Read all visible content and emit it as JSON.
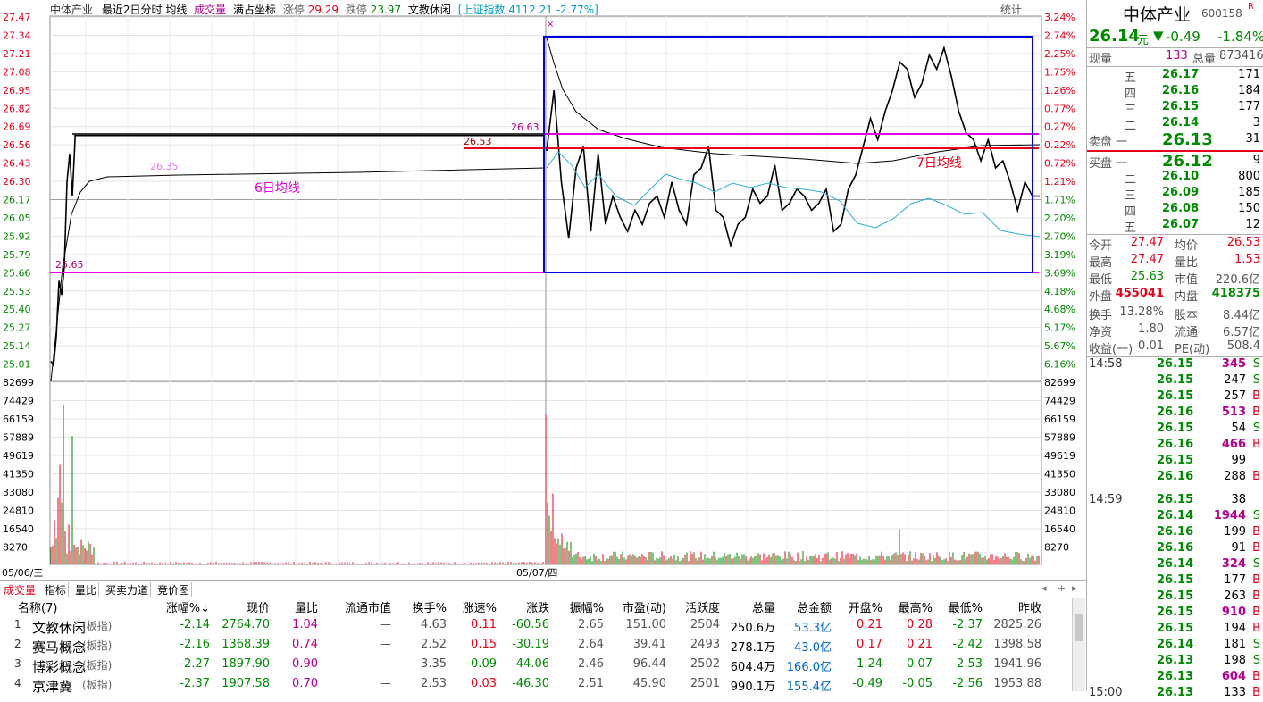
{
  "header": {
    "stock_name": "中体产业",
    "mode": "最近2日分时",
    "avg_label": "均线",
    "vol_label": "成交量",
    "fill_label": "满占坐标",
    "limit_up_label": "涨停",
    "limit_up": "29.29",
    "limit_down_label": "跌停",
    "limit_down": "23.97",
    "sector": "文教休闲",
    "index_label": "[上证指数",
    "index_value": "4112.21",
    "index_change": "-2.77%]",
    "stats_label": "统计"
  },
  "chart_data": {
    "type": "line",
    "price_ticks": [
      "27.47",
      "27.34",
      "27.21",
      "27.08",
      "26.95",
      "26.82",
      "26.69",
      "26.56",
      "26.43",
      "26.30",
      "26.17",
      "26.05",
      "25.92",
      "25.79",
      "25.66",
      "25.53",
      "25.40",
      "25.27",
      "25.14",
      "25.01"
    ],
    "pct_ticks": [
      "3.24%",
      "2.74%",
      "2.25%",
      "1.75%",
      "1.26%",
      "0.77%",
      "0.27%",
      "0.22%",
      "0.72%",
      "1.21%",
      "1.71%",
      "2.20%",
      "2.70%",
      "3.19%",
      "3.69%",
      "4.18%",
      "4.68%",
      "5.17%",
      "5.67%",
      "6.16%"
    ],
    "vol_ticks": [
      "82699",
      "74429",
      "66159",
      "57889",
      "49619",
      "41350",
      "33080",
      "24810",
      "16540",
      "8270"
    ],
    "x_labels": [
      "05/06/三",
      "05/07/四"
    ],
    "annotations": {
      "day1_high": "26.35",
      "day1_low": "25.65",
      "day2_mid": "26.63",
      "red_line": "26.53",
      "avg6_label": "6日均线",
      "avg7_label": "7日均线"
    },
    "day1_price": [
      25.03,
      25.0,
      25.2,
      25.6,
      25.5,
      25.7,
      26.3,
      26.5,
      26.2,
      26.6,
      26.63,
      26.63,
      26.63,
      26.63,
      26.63,
      26.63,
      26.63,
      26.63,
      26.63
    ],
    "day2_price": [
      26.52,
      26.95,
      26.3,
      25.9,
      26.4,
      26.55,
      25.95,
      26.5,
      26.0,
      26.2,
      26.05,
      25.95,
      26.1,
      26.0,
      26.15,
      26.2,
      26.05,
      26.3,
      26.1,
      26.0,
      26.35,
      26.4,
      26.55,
      26.1,
      26.05,
      25.85,
      26.0,
      26.05,
      26.25,
      26.15,
      26.2,
      26.42,
      26.1,
      26.15,
      26.25,
      26.2,
      26.1,
      26.15,
      26.25,
      25.95,
      26.0,
      26.25,
      26.35,
      26.55,
      26.75,
      26.6,
      26.8,
      26.95,
      27.15,
      27.1,
      26.9,
      27.0,
      27.2,
      27.1,
      27.25,
      27.05,
      26.8,
      26.65,
      26.6,
      26.45,
      26.6,
      26.4,
      26.45,
      26.3,
      26.1,
      26.3,
      26.2,
      26.2
    ]
  },
  "quote": {
    "name": "中体产业",
    "code": "600158",
    "r_badge": "R",
    "price": "26.14",
    "unit": "元",
    "arrow": "▼",
    "change": "-0.49",
    "change_pct": "-1.84%",
    "now_label": "现量",
    "now_vol": "133",
    "total_label": "总量",
    "total_vol": "873416",
    "sell": [
      {
        "lvl": "五",
        "price": "26.17",
        "vol": "171"
      },
      {
        "lvl": "四",
        "price": "26.16",
        "vol": "184"
      },
      {
        "lvl": "三",
        "price": "26.15",
        "vol": "177"
      },
      {
        "lvl": "二",
        "price": "26.14",
        "vol": "3"
      },
      {
        "lvl": "卖盘 一",
        "price": "26.13",
        "vol": "31"
      }
    ],
    "buy": [
      {
        "lvl": "买盘 一",
        "price": "26.12",
        "vol": "9"
      },
      {
        "lvl": "二",
        "price": "26.10",
        "vol": "800"
      },
      {
        "lvl": "三",
        "price": "26.09",
        "vol": "185"
      },
      {
        "lvl": "四",
        "price": "26.08",
        "vol": "150"
      },
      {
        "lvl": "五",
        "price": "26.07",
        "vol": "12"
      }
    ],
    "stats": [
      {
        "l1": "今开",
        "v1": "27.47",
        "l2": "均价",
        "v2": "26.53"
      },
      {
        "l1": "最高",
        "v1": "27.47",
        "l2": "量比",
        "v2": "1.53"
      },
      {
        "l1": "最低",
        "v1": "25.63",
        "l2": "市值",
        "v2": "220.6亿"
      },
      {
        "l1": "外盘",
        "v1": "455041",
        "l2": "内盘",
        "v2": "418375"
      },
      {
        "l1": "换手",
        "v1": "13.28%",
        "l2": "股本",
        "v2": "8.44亿"
      },
      {
        "l1": "净资",
        "v1": "1.80",
        "l2": "流通",
        "v2": "6.57亿"
      },
      {
        "l1": "收益(一)",
        "v1": "0.01",
        "l2": "PE(动)",
        "v2": "508.4"
      }
    ],
    "ticks": [
      {
        "t": "14:58",
        "p": "26.15",
        "v": "345",
        "s": "S"
      },
      {
        "t": "",
        "p": "26.15",
        "v": "247",
        "s": "S"
      },
      {
        "t": "",
        "p": "26.15",
        "v": "257",
        "s": "B"
      },
      {
        "t": "",
        "p": "26.16",
        "v": "513",
        "s": "B"
      },
      {
        "t": "",
        "p": "26.15",
        "v": "54",
        "s": "S"
      },
      {
        "t": "",
        "p": "26.16",
        "v": "466",
        "s": "B"
      },
      {
        "t": "",
        "p": "26.15",
        "v": "99",
        "s": ""
      },
      {
        "t": "",
        "p": "26.16",
        "v": "288",
        "s": "B"
      },
      {
        "t": "14:59",
        "p": "26.15",
        "v": "38",
        "s": ""
      },
      {
        "t": "",
        "p": "26.14",
        "v": "1944",
        "s": "S"
      },
      {
        "t": "",
        "p": "26.16",
        "v": "199",
        "s": "B"
      },
      {
        "t": "",
        "p": "26.16",
        "v": "91",
        "s": "B"
      },
      {
        "t": "",
        "p": "26.14",
        "v": "324",
        "s": "S"
      },
      {
        "t": "",
        "p": "26.15",
        "v": "177",
        "s": "B"
      },
      {
        "t": "",
        "p": "26.15",
        "v": "263",
        "s": "B"
      },
      {
        "t": "",
        "p": "26.15",
        "v": "910",
        "s": "B"
      },
      {
        "t": "",
        "p": "26.15",
        "v": "194",
        "s": "B"
      },
      {
        "t": "",
        "p": "26.14",
        "v": "181",
        "s": "S"
      },
      {
        "t": "",
        "p": "26.13",
        "v": "198",
        "s": "S"
      },
      {
        "t": "",
        "p": "26.13",
        "v": "604",
        "s": "B"
      },
      {
        "t": "15:00",
        "p": "26.13",
        "v": "133",
        "s": "B"
      }
    ]
  },
  "tabs": [
    "成交量",
    "指标",
    "量比",
    "买卖力道",
    "竞价图"
  ],
  "table": {
    "headers": [
      "名称(7)",
      "涨幅%↓",
      "现价",
      "量比",
      "流通市值",
      "换手%",
      "涨速%",
      "涨跌",
      "振幅%",
      "市盈(动)",
      "活跃度",
      "总量",
      "总金额",
      "开盘%",
      "最高%",
      "最低%",
      "昨收"
    ],
    "rows": [
      [
        "1",
        "文教休闲",
        "(板指)",
        "-2.14",
        "2764.70",
        "1.04",
        "—",
        "4.63",
        "0.11",
        "-60.56",
        "2.65",
        "151.00",
        "2504",
        "250.6万",
        "53.3亿",
        "0.21",
        "0.28",
        "-2.37",
        "2825.26"
      ],
      [
        "2",
        "赛马概念",
        "(板指)",
        "-2.16",
        "1368.39",
        "0.74",
        "—",
        "2.52",
        "0.15",
        "-30.19",
        "2.64",
        "39.41",
        "2493",
        "278.1万",
        "43.0亿",
        "0.17",
        "0.21",
        "-2.42",
        "1398.58"
      ],
      [
        "3",
        "博彩概念",
        "(板指)",
        "-2.27",
        "1897.90",
        "0.90",
        "—",
        "3.35",
        "-0.09",
        "-44.06",
        "2.46",
        "96.44",
        "2502",
        "604.4万",
        "166.0亿",
        "-1.24",
        "-0.07",
        "-2.53",
        "1941.96"
      ],
      [
        "4",
        "京津冀",
        "(板指)",
        "-2.37",
        "1907.58",
        "0.70",
        "—",
        "2.53",
        "0.03",
        "-46.30",
        "2.51",
        "45.90",
        "2501",
        "990.1万",
        "155.4亿",
        "-0.49",
        "-0.05",
        "-2.56",
        "1953.88"
      ]
    ]
  },
  "colors": {
    "up": "#e8001a",
    "down": "#008a00",
    "magenta": "#e000e0",
    "box": "#0000e0",
    "avg": "#00a0c0"
  }
}
